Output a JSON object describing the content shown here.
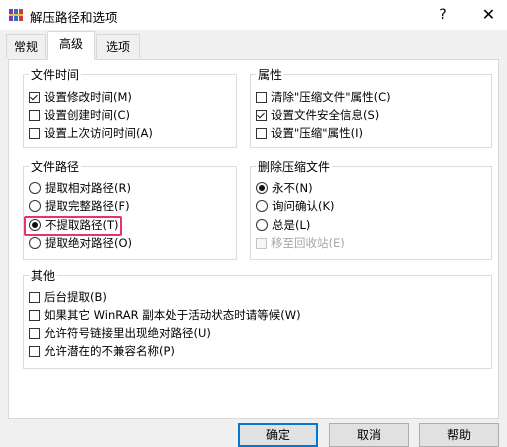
{
  "window": {
    "title": "解压路径和选项",
    "help_glyph": "?",
    "close_glyph": "✕"
  },
  "tabs": [
    {
      "label": "常规"
    },
    {
      "label": "高级"
    },
    {
      "label": "选项"
    }
  ],
  "groups": {
    "file_time": {
      "title": "文件时间",
      "items": [
        {
          "label": "设置修改时间(M)",
          "checked": true
        },
        {
          "label": "设置创建时间(C)",
          "checked": false
        },
        {
          "label": "设置上次访问时间(A)",
          "checked": false
        }
      ]
    },
    "attributes": {
      "title": "属性",
      "items": [
        {
          "label": "清除\"压缩文件\"属性(C)",
          "checked": false
        },
        {
          "label": "设置文件安全信息(S)",
          "checked": true
        },
        {
          "label": "设置\"压缩\"属性(I)",
          "checked": false
        }
      ]
    },
    "file_path": {
      "title": "文件路径",
      "items": [
        {
          "label": "提取相对路径(R)",
          "selected": false
        },
        {
          "label": "提取完整路径(F)",
          "selected": false
        },
        {
          "label": "不提取路径(T)",
          "selected": true
        },
        {
          "label": "提取绝对路径(O)",
          "selected": false
        }
      ]
    },
    "delete_archive": {
      "title": "删除压缩文件",
      "items": [
        {
          "label": "永不(N)",
          "selected": true
        },
        {
          "label": "询问确认(K)",
          "selected": false
        },
        {
          "label": "总是(L)",
          "selected": false
        },
        {
          "label": "移至回收站(E)",
          "checked": false,
          "disabled": true
        }
      ]
    },
    "other": {
      "title": "其他",
      "items": [
        {
          "label": "后台提取(B)",
          "checked": false
        },
        {
          "label": "如果其它 WinRAR 副本处于活动状态时请等候(W)",
          "checked": false
        },
        {
          "label": "允许符号链接里出现绝对路径(U)",
          "checked": false
        },
        {
          "label": "允许潜在的不兼容名称(P)",
          "checked": false
        }
      ]
    }
  },
  "buttons": {
    "ok": "确定",
    "cancel": "取消",
    "help": "帮助"
  },
  "colors": {
    "highlight_border": "#e6336a",
    "default_button_border": "#0078d7"
  }
}
